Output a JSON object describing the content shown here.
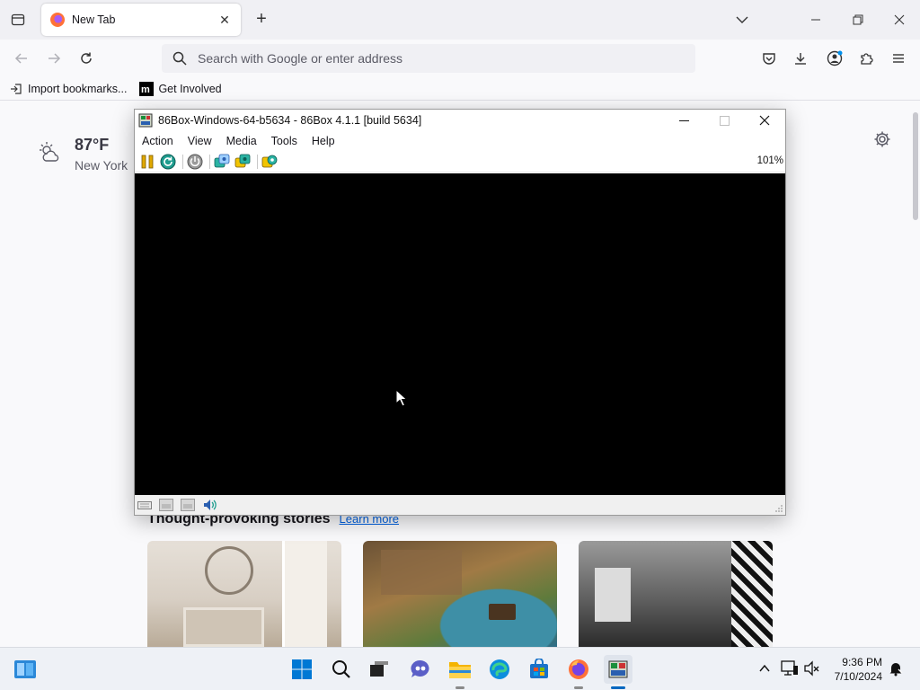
{
  "browser": {
    "tab": {
      "title": "New Tab"
    },
    "url_placeholder": "Search with Google or enter address",
    "bookmarks": [
      {
        "label": "Import bookmarks..."
      },
      {
        "label": "Get Involved"
      }
    ]
  },
  "newtab": {
    "weather": {
      "temp": "87°F",
      "city": "New York"
    },
    "stories": {
      "heading": "Thought-provoking stories",
      "learn_more": "Learn more"
    }
  },
  "vm_window": {
    "title": "86Box-Windows-64-b5634 - 86Box 4.1.1 [build 5634]",
    "menu": [
      "Action",
      "View",
      "Media",
      "Tools",
      "Help"
    ],
    "zoom": "101%"
  },
  "taskbar": {
    "time": "9:36 PM",
    "date": "7/10/2024"
  },
  "colors": {
    "accent": "#0061e0",
    "vm_screen": "#000000",
    "taskbar_indicator": "#0067c0"
  }
}
